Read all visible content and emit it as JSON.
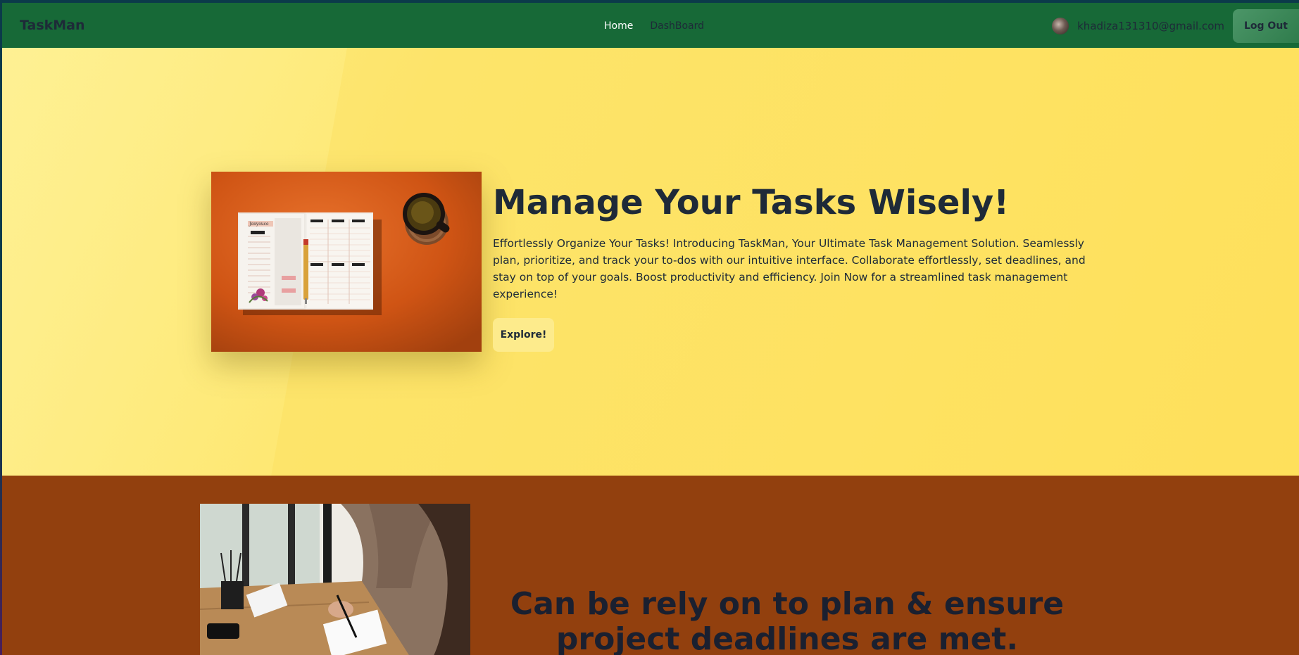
{
  "navbar": {
    "brand": "TaskMan",
    "links": [
      {
        "label": "Home"
      },
      {
        "label": "DashBoard"
      }
    ],
    "user_email": "khadiza131310@gmail.com",
    "logout_label": "Log Out"
  },
  "hero": {
    "title": "Manage Your Tasks Wisely!",
    "description": "Effortlessly Organize Your Tasks! Introducing TaskMan, Your Ultimate Task Management Solution. Seamlessly plan, prioritize, and track your to-dos with our intuitive interface. Collaborate effortlessly, set deadlines, and stay on top of your goals. Boost productivity and efficiency. Join Now for a streamlined task management experience!",
    "explore_label": "Explore!",
    "planner_header": "Jenyouce"
  },
  "section2": {
    "title": "Can be rely on to plan & ensure project deadlines are met."
  },
  "colors": {
    "navbar_bg": "#176937",
    "hero_bg": "#fee05b",
    "section2_bg": "#92400e",
    "text_dark": "#1e2a38"
  }
}
